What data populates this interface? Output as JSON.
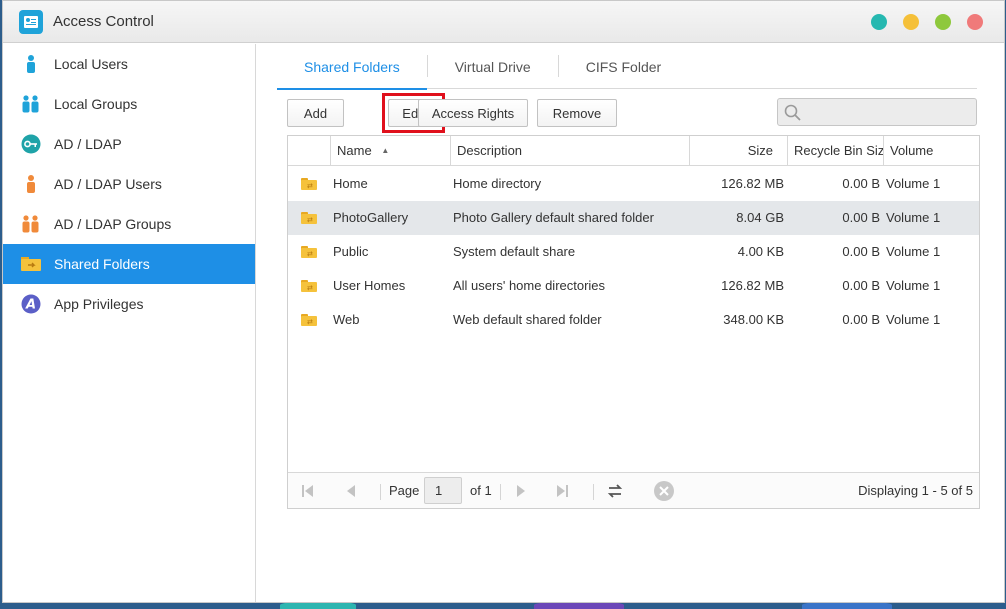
{
  "window": {
    "title": "Access Control"
  },
  "sidebar": {
    "items": [
      {
        "label": "Local Users",
        "icon": "user-icon"
      },
      {
        "label": "Local Groups",
        "icon": "group-icon"
      },
      {
        "label": "AD / LDAP",
        "icon": "key-icon"
      },
      {
        "label": "AD / LDAP Users",
        "icon": "ad-user-icon"
      },
      {
        "label": "AD / LDAP Groups",
        "icon": "ad-group-icon"
      },
      {
        "label": "Shared Folders",
        "icon": "shared-folder-icon",
        "active": true
      },
      {
        "label": "App Privileges",
        "icon": "app-privileges-icon"
      }
    ]
  },
  "tabs": [
    "Shared Folders",
    "Virtual Drive",
    "CIFS Folder"
  ],
  "toolbar": {
    "add": "Add",
    "edit": "Edit",
    "access_rights": "Access Rights",
    "remove": "Remove",
    "search_placeholder": ""
  },
  "grid": {
    "columns": [
      "",
      "Name",
      "Description",
      "Size",
      "Recycle Bin Size",
      "Volume"
    ],
    "sort_indicator": "▲",
    "rows": [
      {
        "name": "Home",
        "description": "Home directory",
        "size": "126.82 MB",
        "recycle": "0.00 B",
        "volume": "Volume 1",
        "selected": false
      },
      {
        "name": "PhotoGallery",
        "description": "Photo Gallery default shared folder",
        "size": "8.04 GB",
        "recycle": "0.00 B",
        "volume": "Volume 1",
        "selected": true
      },
      {
        "name": "Public",
        "description": "System default share",
        "size": "4.00 KB",
        "recycle": "0.00 B",
        "volume": "Volume 1",
        "selected": false
      },
      {
        "name": "User Homes",
        "description": "All users' home directories",
        "size": "126.82 MB",
        "recycle": "0.00 B",
        "volume": "Volume 1",
        "selected": false
      },
      {
        "name": "Web",
        "description": "Web default shared folder",
        "size": "348.00 KB",
        "recycle": "0.00 B",
        "volume": "Volume 1",
        "selected": false
      }
    ]
  },
  "pager": {
    "page_label": "Page",
    "page_value": "1",
    "of_label": "of 1",
    "displaying": "Displaying 1 - 5 of 5"
  },
  "colors": {
    "accent": "#1e8fe6",
    "highlight": "#e0101c",
    "selected_row": "#e4e7ea"
  }
}
